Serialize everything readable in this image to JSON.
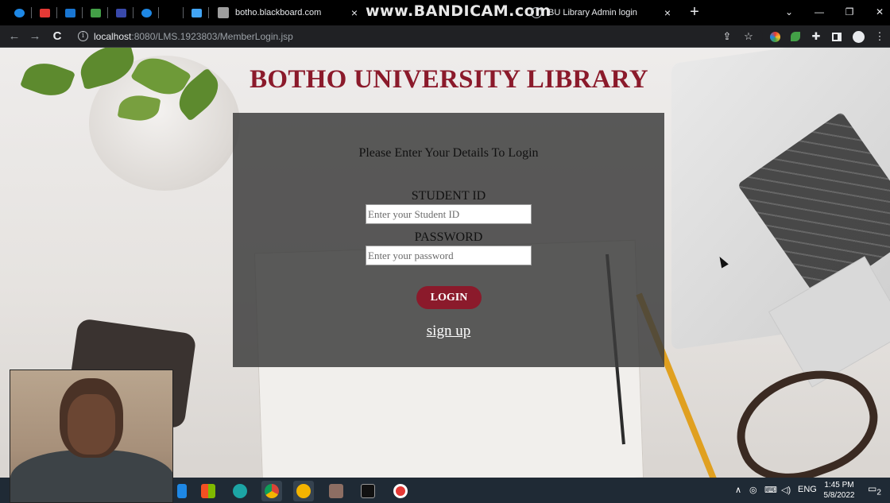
{
  "browser": {
    "tabs": [
      {
        "title": "botho.blackboard.com",
        "close": "×",
        "active": false
      },
      {
        "title": "BU Library Admin login",
        "close": "×",
        "active": false
      }
    ],
    "new_tab": "+",
    "window_controls": {
      "minimize": "—",
      "restore": "❐",
      "close": "✕",
      "tab_search": "⌄"
    },
    "watermark": "www.BANDICAM.com",
    "address": {
      "host": "localhost",
      "path": ":8080/LMS.1923803/MemberLogin.jsp"
    },
    "nav": {
      "back": "←",
      "forward": "→",
      "reload": "C"
    }
  },
  "page": {
    "title": "BOTHO UNIVERSITY LIBRARY",
    "prompt": "Please Enter Your Details To Login",
    "student_id_label": "STUDENT ID",
    "student_id_placeholder": "Enter your Student ID",
    "password_label": "PASSWORD",
    "password_placeholder": "Enter your password",
    "login_button": "LOGIN",
    "signup_link": "sign up"
  },
  "taskbar": {
    "language": "ENG",
    "time": "1:45 PM",
    "date": "5/8/2022",
    "notification_count": "2"
  },
  "colors": {
    "brand": "#8b1a2b",
    "panel": "#3c3c3c",
    "tabstrip": "#000000",
    "toolbar": "#202124",
    "taskbar": "#1f2a35"
  }
}
